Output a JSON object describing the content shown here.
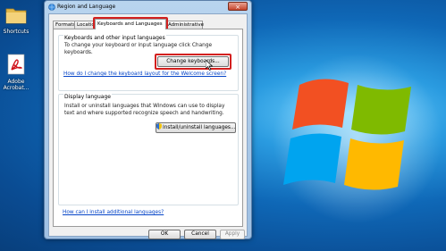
{
  "desktop": {
    "icons": [
      {
        "label": "Shortcuts"
      },
      {
        "label": "Adobe Acrobat..."
      }
    ]
  },
  "dialog": {
    "title": "Region and Language",
    "close_symbol": "×",
    "tabs": [
      {
        "label": "Formats"
      },
      {
        "label": "Location"
      },
      {
        "label": "Keyboards and Languages"
      },
      {
        "label": "Administrative"
      }
    ],
    "keyboards_group": {
      "label": "Keyboards and other input languages",
      "description": "To change your keyboard or input language click Change keyboards.",
      "button": "Change keyboards...",
      "link": "How do I change the keyboard layout for the Welcome screen?"
    },
    "display_group": {
      "label": "Display language",
      "description": "Install or uninstall languages that Windows can use to display text and where supported recognize speech and handwriting.",
      "button": "Install/uninstall languages..."
    },
    "bottom_link": "How can I install additional languages?",
    "footer_buttons": {
      "ok": "OK",
      "cancel": "Cancel",
      "apply": "Apply"
    }
  },
  "colors": {
    "highlight": "#d3201f",
    "link": "#0645c8"
  }
}
